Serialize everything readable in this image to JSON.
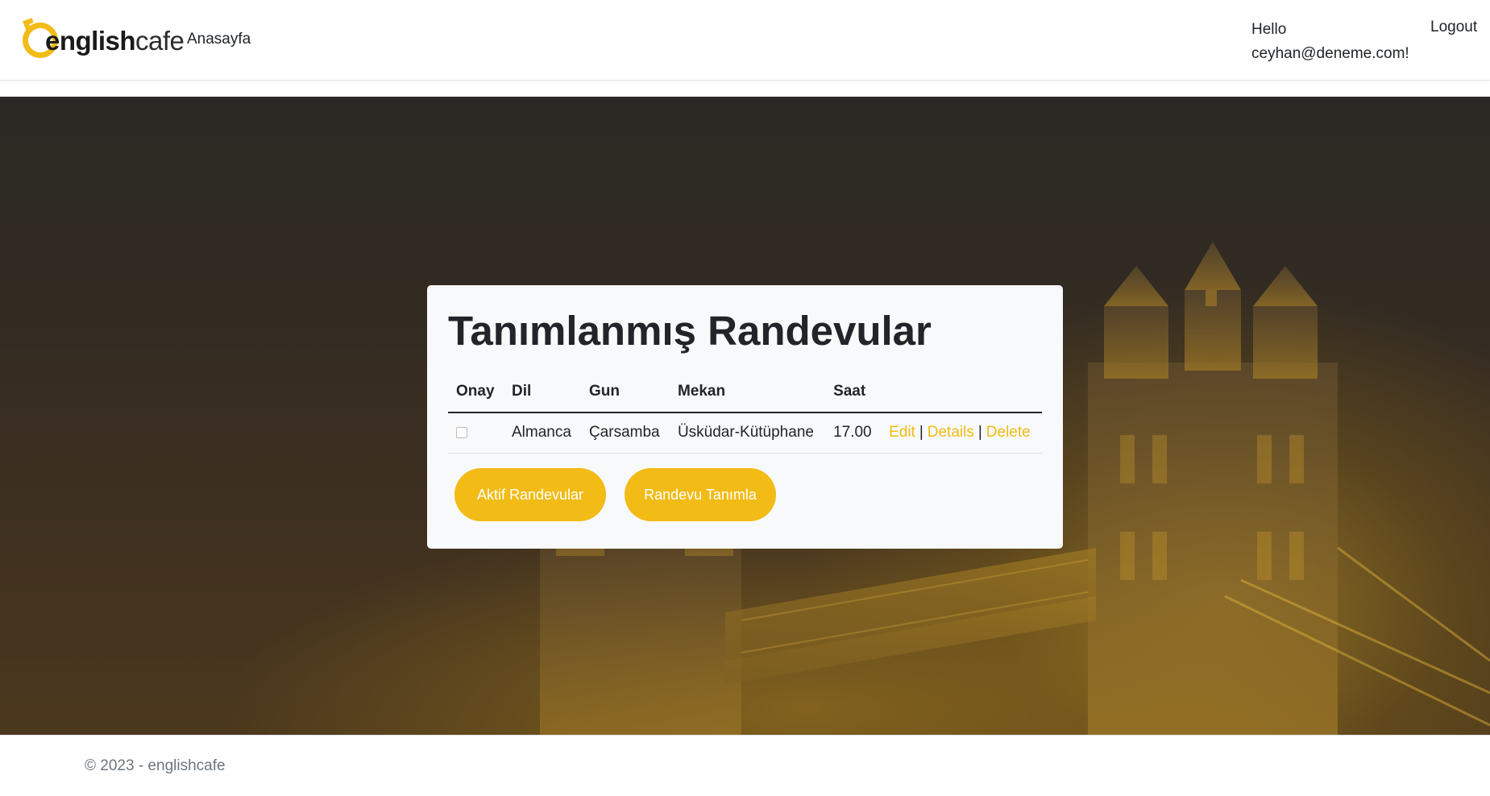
{
  "navbar": {
    "brand": {
      "part1": "english",
      "part2": "cafe"
    },
    "home_link": "Anasayfa",
    "greeting": "Hello ceyhan@deneme.com!",
    "logout": "Logout"
  },
  "card": {
    "title": "Tanımlanmış Randevular",
    "columns": [
      "Onay",
      "Dil",
      "Gun",
      "Mekan",
      "Saat"
    ],
    "rows": [
      {
        "approved": false,
        "language": "Almanca",
        "day": "Çarsamba",
        "venue": "Üsküdar-Kütüphane",
        "time": "17.00",
        "actions": {
          "edit": "Edit",
          "details": "Details",
          "delete": "Delete",
          "separator": "|"
        }
      }
    ],
    "buttons": {
      "active": "Aktif Randevular",
      "create": "Randevu Tanımla"
    }
  },
  "footer": {
    "text": "© 2023 - englishcafe"
  },
  "colors": {
    "accent": "#f2bb16",
    "text": "#212529",
    "muted": "#6c757d",
    "card_bg": "#f8f9fa"
  },
  "icons": {
    "brand_mark": "brand-ring-icon"
  }
}
